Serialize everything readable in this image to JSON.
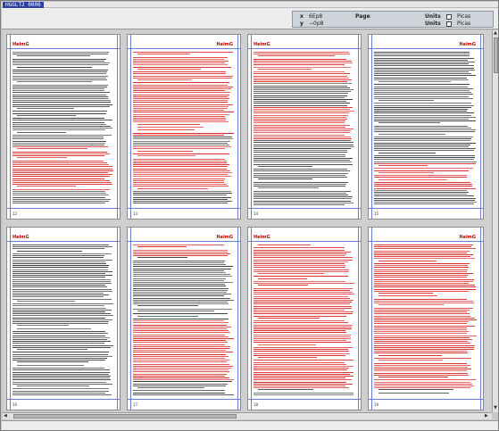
{
  "window": {
    "title": "HGGLT2 0006"
  },
  "coords": {
    "x_label": "x",
    "x_value": "6Ep8",
    "y_label": "y",
    "y_value": "−0p8",
    "page_label": "Page",
    "units_label_1": "Units",
    "units_value_1": "Picas",
    "units_label_2": "Units",
    "units_value_2": "Picas"
  },
  "pages": [
    {
      "header_left": "HeimG",
      "header_right": "",
      "footer_num": "12"
    },
    {
      "header_left": "",
      "header_right": "HeimG",
      "footer_num": "13"
    },
    {
      "header_left": "HeimG",
      "header_right": "",
      "footer_num": "14"
    },
    {
      "header_left": "",
      "header_right": "HeimG",
      "footer_num": "15"
    },
    {
      "header_left": "HeimG",
      "header_right": "",
      "footer_num": "16"
    },
    {
      "header_left": "",
      "header_right": "HeimG",
      "footer_num": "17"
    },
    {
      "header_left": "HeimG",
      "header_right": "",
      "footer_num": "18"
    },
    {
      "header_left": "",
      "header_right": "HeimG",
      "footer_num": "19"
    }
  ],
  "colors": {
    "text_black": "#1a1a1a",
    "text_red": "#d40000",
    "guide": "#6b7bd6",
    "title_bg": "#2c3fa3"
  },
  "icons": {
    "scroll_up": "triangle-up-icon",
    "scroll_down": "triangle-down-icon",
    "scroll_left": "triangle-left-icon",
    "scroll_right": "triangle-right-icon"
  }
}
